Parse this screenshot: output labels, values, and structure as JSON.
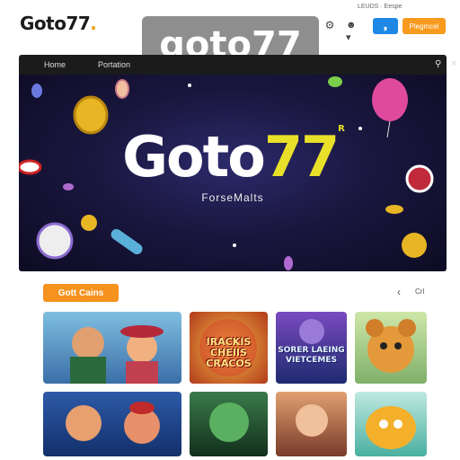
{
  "header": {
    "logo_text": "Goto77",
    "logo_dot": ".",
    "watermark": "goto77",
    "top_small_text": "LEUDS · Eespe",
    "social_button": "❟",
    "signup_button": "Plegmcel"
  },
  "nav": {
    "items": [
      {
        "label": "Home"
      },
      {
        "label": "Portation"
      }
    ]
  },
  "hero": {
    "title_main": "Goto",
    "title_accent": "77",
    "title_suffix": "R",
    "subtitle": "ForseMalts"
  },
  "section": {
    "heading": "Gott Cains",
    "more_label": "Crl"
  },
  "games": [
    {
      "label": ""
    },
    {
      "label": "IRACKIS CHEIIS CRACOS"
    },
    {
      "label": "SORER LAEING VIETCEMES"
    },
    {
      "label": ""
    },
    {
      "label": ""
    },
    {
      "label": ""
    },
    {
      "label": ""
    },
    {
      "label": ""
    }
  ],
  "colors": {
    "accent_orange": "#f6921e",
    "accent_blue": "#1e88e5",
    "hero_bg": "#1a1740",
    "hero_accent": "#e9e02a"
  }
}
